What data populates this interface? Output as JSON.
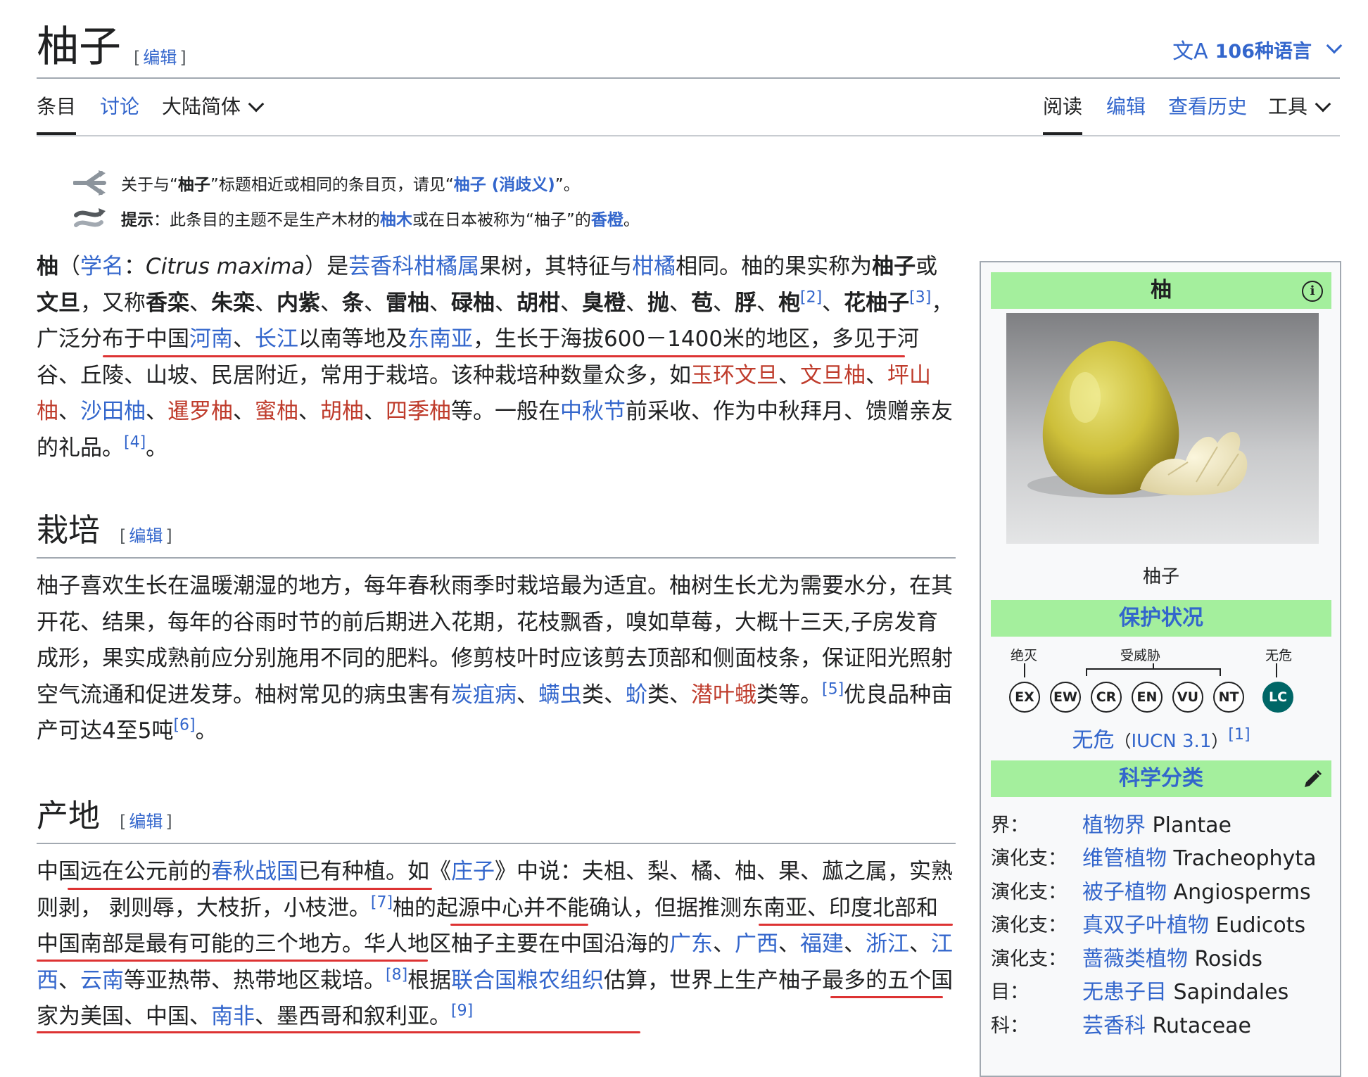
{
  "header": {
    "title": "柚子",
    "edit_label": "编辑",
    "languages": "106种语言",
    "lang_icon": "文A"
  },
  "tabs": {
    "article": "条目",
    "talk": "讨论",
    "variant": "大陆简体",
    "read": "阅读",
    "edit": "编辑",
    "history": "查看历史",
    "tools": "工具"
  },
  "hatnotes": {
    "h1_a": "关于与“",
    "h1_b": "柚子",
    "h1_c": "”标题相近或相同的条目页，请见“",
    "h1_link": "柚子 (消歧义)",
    "h1_d": "”。",
    "h2_label": "提示",
    "h2_a": "：此条目的主题不是生产木材的",
    "h2_link1": "柚木",
    "h2_b": "或在日本被称为“柚子”的",
    "h2_link2": "香橙",
    "h2_c": "。"
  },
  "intro": {
    "t01": "柚",
    "t02": "（",
    "t03": "学名",
    "t04": "：",
    "t05": "Citrus maxima",
    "t06": "）是",
    "t07": "芸香科",
    "t08": "柑橘属",
    "t09": "果树，其特征与",
    "t10": "柑橘",
    "t11": "相同。柚的果实称为",
    "t12": "柚子",
    "t13": "或",
    "t14": "文旦",
    "t15": "，又称",
    "t16": "香栾",
    "t17": "朱栾",
    "t18": "内紫",
    "t19": "条",
    "t20": "雷柚",
    "t21": "碌柚",
    "t22": "胡柑",
    "t23": "臭橙",
    "t24": "抛",
    "t25": "苞",
    "t26": "脬",
    "t27": "枹",
    "t28": "[2]",
    "t29": "花柚子",
    "t30": "[3]",
    "t31": "，广泛分布于中国",
    "t32": "河南",
    "t33": "长江",
    "t34": "以南等地及",
    "t35": "东南亚",
    "t36": "，生长于海拔600－1400米的地区，多见于河谷、丘陵、山坡、民居附近，常用于栽培。该种栽培种数量众多，如",
    "t37": "玉环文旦",
    "t38": "文旦柚",
    "t39": "坪山柚",
    "t40": "沙田柚",
    "t41": "暹罗柚",
    "t42": "蜜柚",
    "t43": "胡柚",
    "t44": "四季柚",
    "t45": "等。一般在",
    "t46": "中秋节",
    "t47": "前采收、作为中秋拜月、馈赠亲友的礼品。",
    "t48": "[4]",
    "t49": "。",
    "sep": "、"
  },
  "cultivation": {
    "heading": "栽培",
    "p1": "柚子喜欢生长在温暖潮湿的地方，每年春秋雨季时栽培最为适宜。柚树生长尤为需要水分，在其开花、结果，每年的谷雨时节的前后期进入花期，花枝飘香，嗅如草莓，大概十三天,子房发育成形，果实成熟前应分别施用不同的肥料。修剪枝叶时应该剪去顶部和侧面枝条，保证阳光照射空气流通和促进发芽。柚树常见的病虫害有",
    "l1": "炭疽病",
    "s1": "、",
    "l2": "螨虫",
    "s2": "类、",
    "l3": "蚧",
    "s3": "类、",
    "l4": "潜叶蛾",
    "s4": "类等。",
    "ref5": "[5]",
    "p2": "优良品种亩产可达4至5吨",
    "ref6": "[6]",
    "p3": "。"
  },
  "origin": {
    "heading": "产地",
    "a": "中国远在公元前的",
    "l1": "春秋战国",
    "b": "已有种植。如《",
    "l2": "庄子",
    "c": "》中说：夫柤、梨、橘、柚、果、蓏之属，实熟则剥， 剥则辱，大枝折，小枝泄。",
    "ref7": "[7]",
    "d": "柚的起源中心并不能确认，但据推测东南亚、印度北部和中国南部是最有可能的三个地方。华人地区柚子主要在中国沿海的",
    "l3": "广东",
    "sep": "、",
    "l4": "广西",
    "l5": "福建",
    "l6": "浙江",
    "l7": "江西",
    "l8": "云南",
    "e": "等亚热带、热带地区栽培。",
    "ref8": "[8]",
    "f": "根据",
    "l9": "联合国粮农组织",
    "g": "估算，世界上生产柚子最多的五个国家为美国、中国、",
    "l10": "南非",
    "h": "、墨西哥和叙利亚。",
    "ref9": "[9]"
  },
  "infobox": {
    "title": "柚",
    "info_icon": "i",
    "caption": "柚子",
    "conservation_heading": "保护状况",
    "label_extinct": "绝灭",
    "label_threatened": "受威胁",
    "label_safe": "无危",
    "statuses": [
      "EX",
      "EW",
      "CR",
      "EN",
      "VU",
      "NT",
      "LC"
    ],
    "status_text": "无危",
    "status_paren_open": "（",
    "status_source": "IUCN 3.1",
    "status_paren_close": "）",
    "status_ref": "[1]",
    "taxonomy_heading": "科学分类",
    "taxonomy": [
      {
        "rank": "界：",
        "name": "植物界",
        "latin": "Plantae"
      },
      {
        "rank": "演化支：",
        "name": "维管植物",
        "latin": "Tracheophyta"
      },
      {
        "rank": "演化支：",
        "name": "被子植物",
        "latin": "Angiosperms"
      },
      {
        "rank": "演化支：",
        "name": "真双子叶植物",
        "latin": "Eudicots"
      },
      {
        "rank": "演化支：",
        "name": "蔷薇类植物",
        "latin": "Rosids"
      },
      {
        "rank": "目：",
        "name": "无患子目",
        "latin": "Sapindales"
      },
      {
        "rank": "科：",
        "name": "芸香科",
        "latin": "Rutaceae"
      }
    ]
  },
  "colors": {
    "link": "#3366cc",
    "redlink": "#bf3c2c",
    "infobox_header": "#a4ef9d",
    "least_concern": "#006666",
    "annotation_underline": "#dd3333"
  }
}
